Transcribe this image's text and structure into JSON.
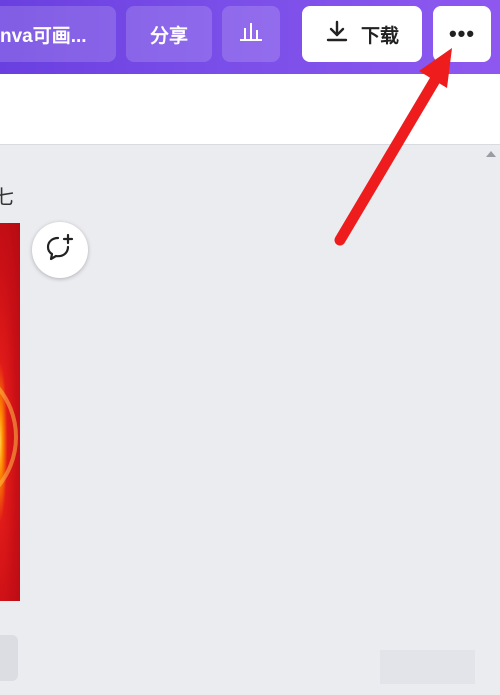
{
  "toolbar": {
    "title_label": "nva可画...",
    "share_label": "分享",
    "stats_icon": "bar-chart-icon",
    "download_label": "下载",
    "download_icon": "download-icon",
    "more_label": "•••"
  },
  "workspace": {
    "page_label": "七",
    "comment_icon": "add-comment-icon"
  },
  "annotation": {
    "arrow_color": "#ee1c1c",
    "target": "more-button"
  },
  "colors": {
    "toolbar_start": "#6a3fe0",
    "toolbar_end": "#8e58f0",
    "canvas_bg": "#ebecf0",
    "design_red": "#c80f16"
  }
}
